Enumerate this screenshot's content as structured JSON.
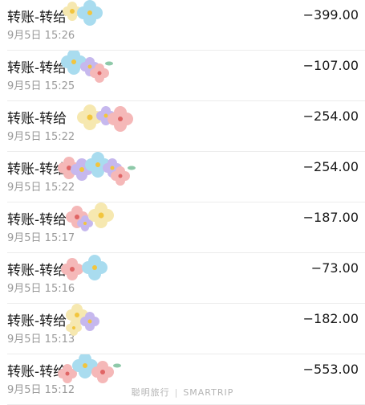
{
  "transactions": [
    {
      "title": "转账-转给",
      "time": "9月5日 15:26",
      "amount": "−399.00"
    },
    {
      "title": "转账-转给",
      "time": "9月5日 15:25",
      "amount": "−107.00"
    },
    {
      "title": "转账-转给",
      "time": "9月5日 15:22",
      "amount": "−254.00"
    },
    {
      "title": "转账-转给",
      "time": "9月5日 15:22",
      "amount": "−254.00"
    },
    {
      "title": "转账-转给",
      "time": "9月5日 15:17",
      "amount": "−187.00"
    },
    {
      "title": "转账-转给",
      "time": "9月5日 15:16",
      "amount": "−73.00"
    },
    {
      "title": "转账-转给",
      "time": "9月5日 15:13",
      "amount": "−182.00"
    },
    {
      "title": "转账-转给",
      "time": "9月5日 15:12",
      "amount": "−553.00"
    }
  ],
  "watermark": {
    "left": "聪明旅行",
    "separator": "|",
    "right": "SMARTRIP"
  },
  "icons": {
    "sticker": "flower-sticker-icon"
  },
  "colors": {
    "text": "#1a1a1a",
    "subtext": "#9a9a9a",
    "divider": "#ececec"
  }
}
